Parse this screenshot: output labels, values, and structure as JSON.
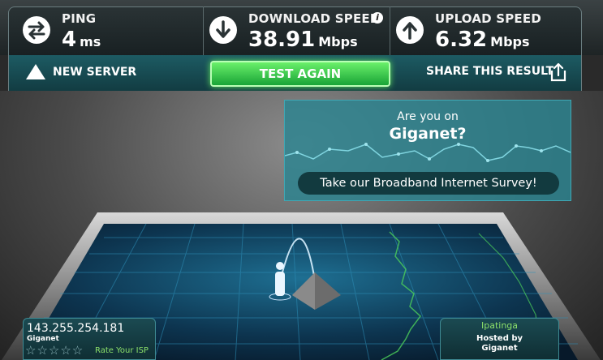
{
  "metrics": {
    "ping": {
      "label": "PING",
      "value": "4",
      "unit": "ms",
      "icon": "swap-arrows-icon"
    },
    "download": {
      "label": "DOWNLOAD SPEED",
      "value": "38.91",
      "unit": "Mbps",
      "icon": "download-arrow-icon",
      "info": "i"
    },
    "upload": {
      "label": "UPLOAD SPEED",
      "value": "6.32",
      "unit": "Mbps",
      "icon": "upload-arrow-icon"
    }
  },
  "actions": {
    "new_server": "NEW SERVER",
    "test_again": "TEST AGAIN",
    "share": "SHARE THIS RESULT"
  },
  "promo": {
    "question": "Are you on",
    "isp_question": "Giganet?",
    "survey_button": "Take our Broadband Internet Survey!"
  },
  "client": {
    "ip": "143.255.254.181",
    "isp": "Giganet",
    "stars": "☆☆☆☆☆",
    "rate_label": "Rate Your ISP"
  },
  "server": {
    "city": "Ipatinga",
    "hosted_by": "Hosted by",
    "host": "Giganet"
  },
  "colors": {
    "accent_green": "#2fc94a",
    "teal_panel": "#2b8490",
    "grid_blue": "#1d6a8a"
  }
}
